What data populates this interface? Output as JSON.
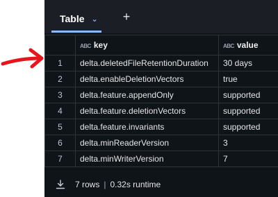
{
  "tab": {
    "label": "Table"
  },
  "columns": [
    {
      "label": "key",
      "type_badge": "ABC"
    },
    {
      "label": "value",
      "type_badge": "ABC"
    }
  ],
  "rows": [
    {
      "num": "1",
      "key": "delta.deletedFileRetentionDuration",
      "value": "30 days"
    },
    {
      "num": "2",
      "key": "delta.enableDeletionVectors",
      "value": "true"
    },
    {
      "num": "3",
      "key": "delta.feature.appendOnly",
      "value": "supported"
    },
    {
      "num": "4",
      "key": "delta.feature.deletionVectors",
      "value": "supported"
    },
    {
      "num": "5",
      "key": "delta.feature.invariants",
      "value": "supported"
    },
    {
      "num": "6",
      "key": "delta.minReaderVersion",
      "value": "3"
    },
    {
      "num": "7",
      "key": "delta.minWriterVersion",
      "value": "7"
    }
  ],
  "footer": {
    "rows": "7 rows",
    "separator": "|",
    "runtime": "0.32s runtime"
  },
  "icons": {
    "tab_menu": "chevron-down-icon",
    "add_tab": "plus-icon",
    "download": "download-icon",
    "annotation": "red-arrow-icon"
  },
  "colors": {
    "annotation": "#e8141b",
    "accent": "#8fb8ff",
    "background": "#0f1419"
  }
}
